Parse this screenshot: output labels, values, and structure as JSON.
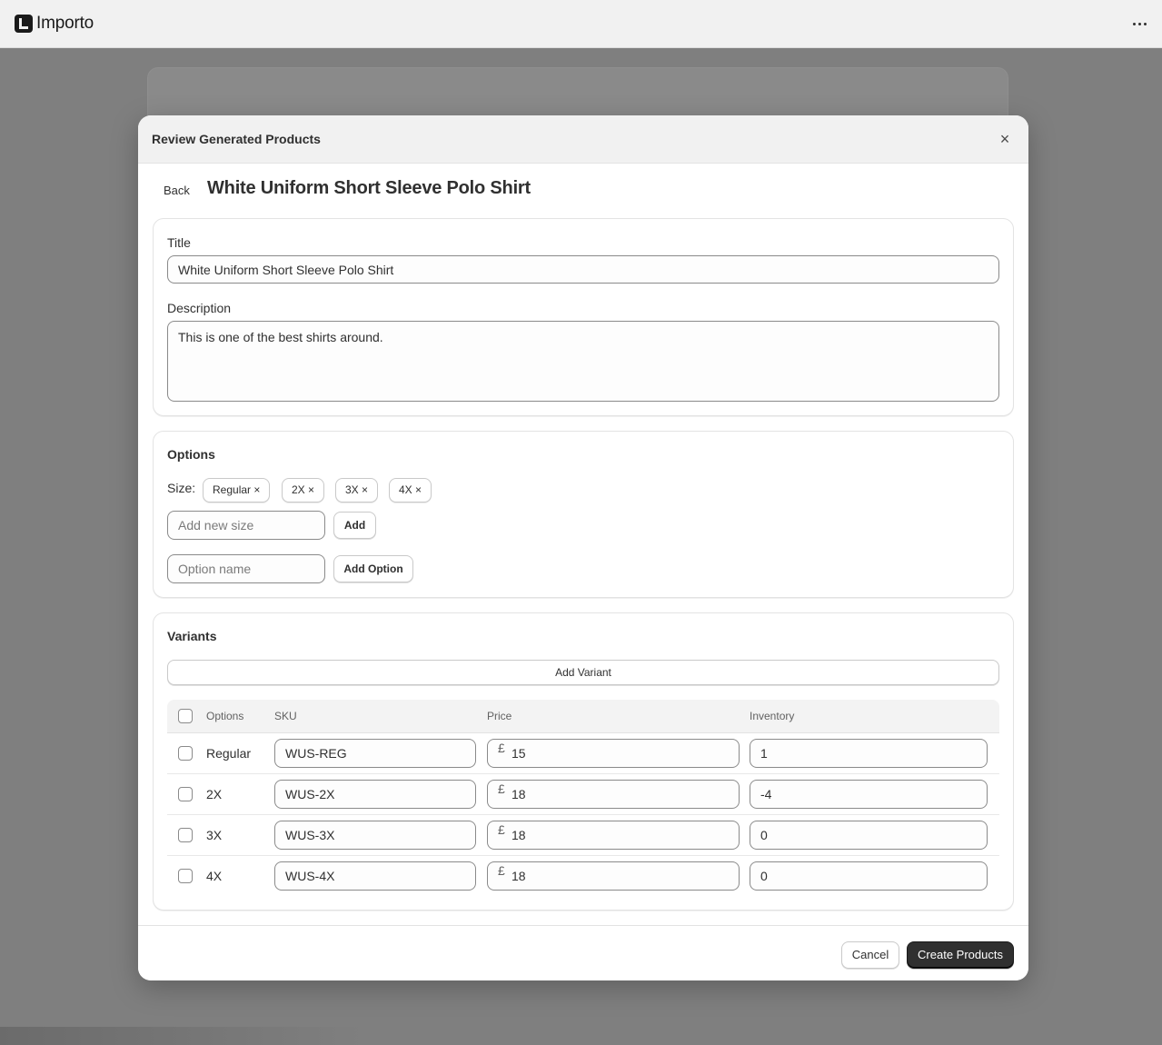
{
  "app": {
    "name": "Importo"
  },
  "modal": {
    "title": "Review Generated Products",
    "close_label": "×",
    "back_label": "Back",
    "product_heading": "White Uniform Short Sleeve Polo Shirt"
  },
  "details": {
    "title_label": "Title",
    "title_value": "White Uniform Short Sleeve Polo Shirt",
    "description_label": "Description",
    "description_value": "This is one of the best shirts around."
  },
  "options": {
    "section_title": "Options",
    "size_label": "Size:",
    "sizes": [
      "Regular ×",
      "2X ×",
      "3X ×",
      "4X ×"
    ],
    "new_size_placeholder": "Add new size",
    "add_label": "Add",
    "option_name_placeholder": "Option name",
    "add_option_label": "Add Option"
  },
  "variants": {
    "section_title": "Variants",
    "add_variant_label": "Add Variant",
    "columns": [
      "Options",
      "SKU",
      "Price",
      "Inventory"
    ],
    "currency_symbol": "£",
    "rows": [
      {
        "option": "Regular",
        "sku": "WUS-REG",
        "price": "15",
        "inventory": "1"
      },
      {
        "option": "2X",
        "sku": "WUS-2X",
        "price": "18",
        "inventory": "-4"
      },
      {
        "option": "3X",
        "sku": "WUS-3X",
        "price": "18",
        "inventory": "0"
      },
      {
        "option": "4X",
        "sku": "WUS-4X",
        "price": "18",
        "inventory": "0"
      }
    ]
  },
  "footer": {
    "cancel_label": "Cancel",
    "create_label": "Create Products"
  }
}
